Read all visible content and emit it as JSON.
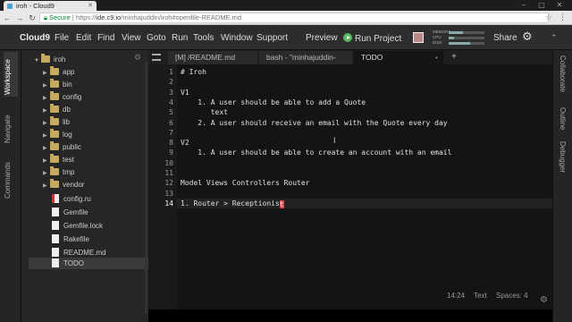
{
  "browser": {
    "tab_title": "iroh - Cloud9",
    "url_secure": "Secure",
    "url_scheme": "https://",
    "url_host": "ide.c9.io",
    "url_path": "/minhajuddin/iroh#openfile-README.md"
  },
  "menubar": {
    "brand": "Cloud9",
    "items": [
      "File",
      "Edit",
      "Find",
      "View",
      "Goto",
      "Run",
      "Tools",
      "Window",
      "Support"
    ],
    "preview": "Preview",
    "run_project": "Run Project",
    "meters": [
      {
        "label": "MEMORY",
        "level": 0.4
      },
      {
        "label": "CPU",
        "level": 0.15
      },
      {
        "label": "DISK",
        "level": 0.6
      }
    ],
    "share": "Share"
  },
  "leftbar": {
    "workspace": "Workspace",
    "navigate": "Navigate",
    "commands": "Commands"
  },
  "rightbar": {
    "collaborate": "Collaborate",
    "outline": "Outline",
    "debugger": "Debugger"
  },
  "tree": {
    "root": "iroh",
    "folders": [
      "app",
      "bin",
      "config",
      "db",
      "lib",
      "log",
      "public",
      "test",
      "tmp",
      "vendor"
    ],
    "files": [
      "config.ru",
      "Gemfile",
      "Gemfile.lock",
      "Rakefile",
      "README.md",
      "TODO"
    ],
    "selected": "TODO"
  },
  "tabs": [
    {
      "label": "[M] /README.md",
      "active": false
    },
    {
      "label": "bash - \"minhajuddin-",
      "active": false
    },
    {
      "label": "TODO",
      "active": true
    }
  ],
  "editor": {
    "lines": [
      "# Iroh",
      "",
      "V1",
      "    1. A user should be able to add a Quote",
      "       text",
      "    2. A user should receive an email with the Quote every day",
      "",
      "V2",
      "    1. A user should be able to create an account with an email",
      "",
      "",
      "Model Views Controllers Router",
      "",
      "1. Router > Receptionis"
    ],
    "cursor_char": "t",
    "current_line": 14
  },
  "status": {
    "position": "14:24",
    "mode": "Text",
    "spaces": "Spaces: 4"
  }
}
